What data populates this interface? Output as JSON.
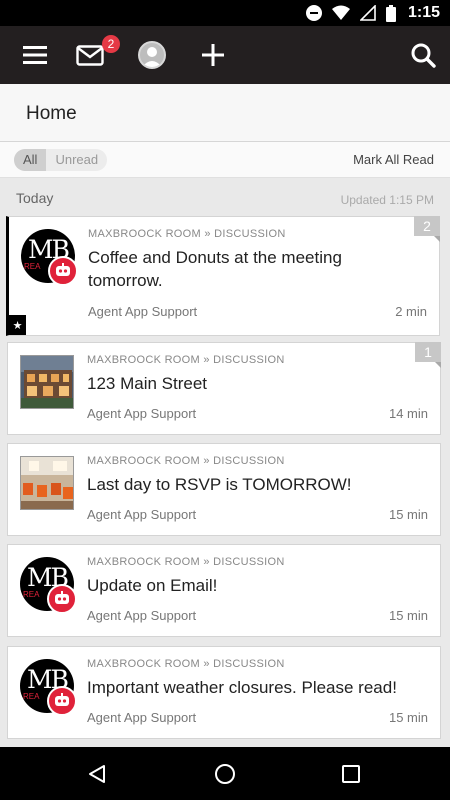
{
  "status_bar": {
    "time": "1:15",
    "icons": [
      "dnd-icon",
      "wifi-icon",
      "signal-icon",
      "battery-icon"
    ]
  },
  "toolbar": {
    "icons": [
      "menu-icon",
      "mail-icon",
      "profile-icon",
      "add-icon",
      "search-icon"
    ],
    "mail_badge": "2",
    "background": "#231f20",
    "badge_color": "#e53945"
  },
  "page": {
    "title": "Home"
  },
  "filter": {
    "all_label": "All",
    "unread_label": "Unread",
    "selected": "All",
    "mark_all_label": "Mark All Read"
  },
  "section": {
    "label": "Today",
    "updated": "Updated 1:15 PM"
  },
  "items": [
    {
      "room": "MAXBROOCK ROOM » DISCUSSION",
      "title": "Coffee and Donuts at the meeting tomorrow.",
      "author": "Agent App Support",
      "time": "2 min",
      "count": "2",
      "thumb": "logo",
      "logo_text": "MB",
      "logo_sub": "REA",
      "pinned": true
    },
    {
      "room": "MAXBROOCK ROOM » DISCUSSION",
      "title": "123 Main Street",
      "author": "Agent App Support",
      "time": "14 min",
      "count": "1",
      "thumb": "house-photo",
      "pinned": false
    },
    {
      "room": "MAXBROOCK ROOM » DISCUSSION",
      "title": "Last day to RSVP is TOMORROW!",
      "author": "Agent App Support",
      "time": "15 min",
      "count": "",
      "thumb": "restaurant-photo",
      "pinned": false
    },
    {
      "room": "MAXBROOCK ROOM » DISCUSSION",
      "title": "Update on Email!",
      "author": "Agent App Support",
      "time": "15 min",
      "count": "",
      "thumb": "logo",
      "logo_text": "MB",
      "logo_sub": "REA",
      "pinned": false
    },
    {
      "room": "MAXBROOCK ROOM » DISCUSSION",
      "title": "Important weather closures. Please read!",
      "author": "Agent App Support",
      "time": "15 min",
      "count": "",
      "thumb": "logo",
      "logo_text": "MB",
      "logo_sub": "REA",
      "pinned": false
    }
  ],
  "nav_bar": {
    "icons": [
      "back-icon",
      "home-icon",
      "recents-icon"
    ]
  },
  "colors": {
    "accent_red": "#e0223a",
    "pinned_marker": "#000000"
  }
}
